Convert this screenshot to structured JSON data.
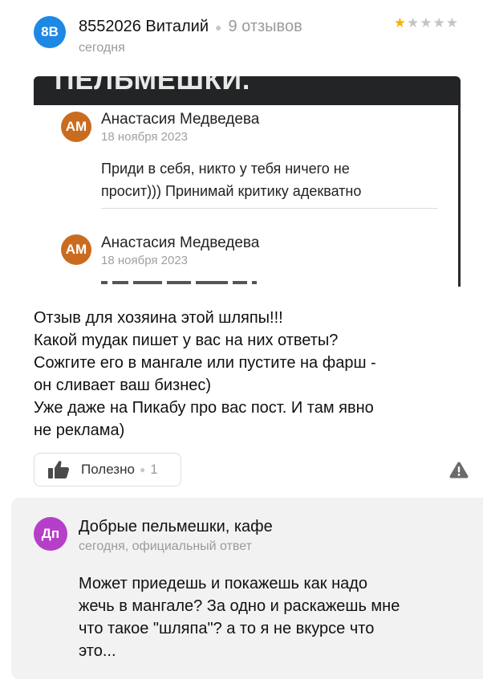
{
  "review": {
    "avatar_initials": "8В",
    "author": "8552026 Виталий",
    "review_count": "9 отзывов",
    "date": "сегодня",
    "rating": 1,
    "rating_max": 5,
    "stars": [
      "★",
      "★",
      "★",
      "★",
      "★"
    ],
    "text_lines": [
      "Отзыв для хозяина этой шляпы!!!",
      "Какой mудак пишет у вас на них ответы?",
      "Сожгите его в мангале или пустите на фарш -",
      "он сливает ваш бизнес)",
      "Уже даже на Пикабу про вас пост. И там явно",
      "не реклама)"
    ]
  },
  "photo": {
    "banner_text": "ПЕЛЬМЕШКИ.",
    "comments": [
      {
        "initials": "АМ",
        "name": "Анастасия Медведева",
        "date": "18 ноября 2023",
        "text_lines": [
          "Приди в себя, никто у тебя ничего не",
          "просит))) Принимай критику адекватно"
        ]
      },
      {
        "initials": "АМ",
        "name": "Анастасия Медведева",
        "date": "18 ноября 2023",
        "text_lines": []
      }
    ]
  },
  "actions": {
    "useful_label": "Полезно",
    "useful_count": "1",
    "icons": {
      "thumb": "thumbs-up-icon",
      "report": "warning-icon"
    }
  },
  "reply": {
    "avatar_initials": "Дп",
    "name": "Добрые пельмешки, кафе",
    "meta": "сегодня, официальный ответ",
    "text_lines": [
      "Может приедешь и покажешь как надо",
      "жечь в мангале? За одно и раскажешь мне",
      "что такое \"шляпа\"? а то я не вкурсе что",
      "это..."
    ]
  },
  "colors": {
    "author_avatar": "#1e88e5",
    "commenter_avatar": "#c96c1f",
    "reply_avatar": "#b63fc9",
    "star_active": "#f2b400",
    "star_inactive": "#c4c4c4",
    "reply_background": "#f2f2f2"
  }
}
